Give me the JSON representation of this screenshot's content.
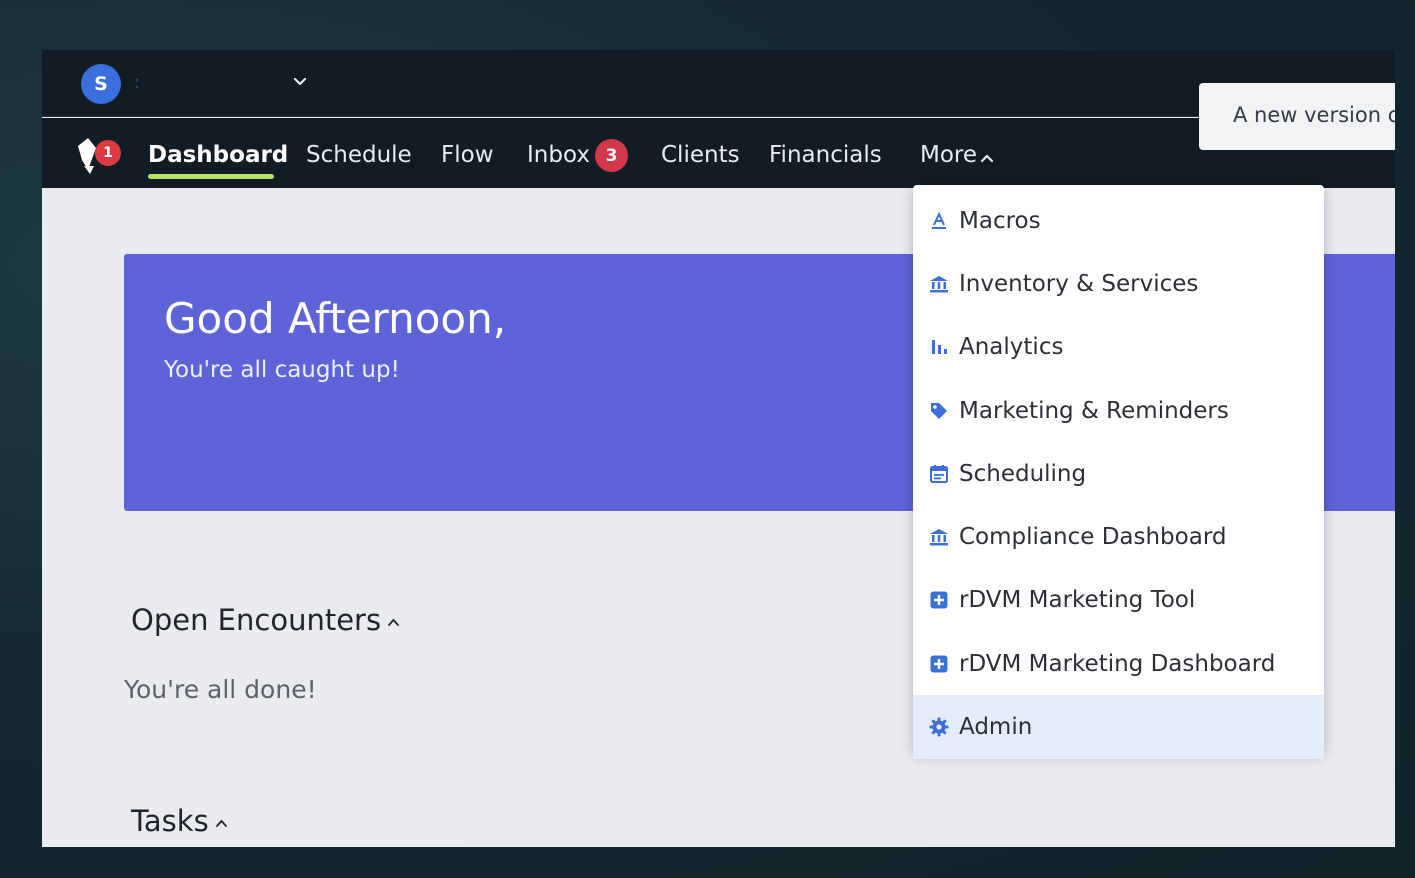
{
  "account": {
    "avatar_initial": "S",
    "separator": ":"
  },
  "nav": {
    "logo_badge": "1",
    "items": [
      {
        "label": "Dashboard",
        "active": true
      },
      {
        "label": "Schedule"
      },
      {
        "label": "Flow"
      },
      {
        "label": "Inbox"
      },
      {
        "label": "Clients"
      },
      {
        "label": "Financials"
      },
      {
        "label": "More"
      }
    ],
    "inbox_badge": "3"
  },
  "toast": {
    "text": "A new version of"
  },
  "greeting": {
    "title": "Good Afternoon,",
    "subtitle": "You're all caught up!"
  },
  "sections": {
    "open_encounters": {
      "title": "Open Encounters",
      "empty_text": "You're all done!"
    },
    "tasks": {
      "title": "Tasks"
    }
  },
  "more_menu": {
    "items": [
      {
        "label": "Macros",
        "icon": "macros-icon"
      },
      {
        "label": "Inventory & Services",
        "icon": "bank-icon"
      },
      {
        "label": "Analytics",
        "icon": "bar-chart-icon"
      },
      {
        "label": "Marketing & Reminders",
        "icon": "tags-icon"
      },
      {
        "label": "Scheduling",
        "icon": "calendar-icon"
      },
      {
        "label": "Compliance Dashboard",
        "icon": "bank-icon"
      },
      {
        "label": "rDVM Marketing Tool",
        "icon": "plus-square-icon"
      },
      {
        "label": "rDVM Marketing Dashboard",
        "icon": "plus-square-icon"
      },
      {
        "label": "Admin",
        "icon": "gear-icon",
        "highlighted": true
      }
    ]
  },
  "colors": {
    "nav_bg": "#111c24",
    "greeting_bg": "#5e63d8",
    "active_underline": "#b7e36a",
    "badge_red": "#d2374a",
    "icon_blue": "#3c6fd8",
    "menu_hover": "#e4edf9"
  }
}
